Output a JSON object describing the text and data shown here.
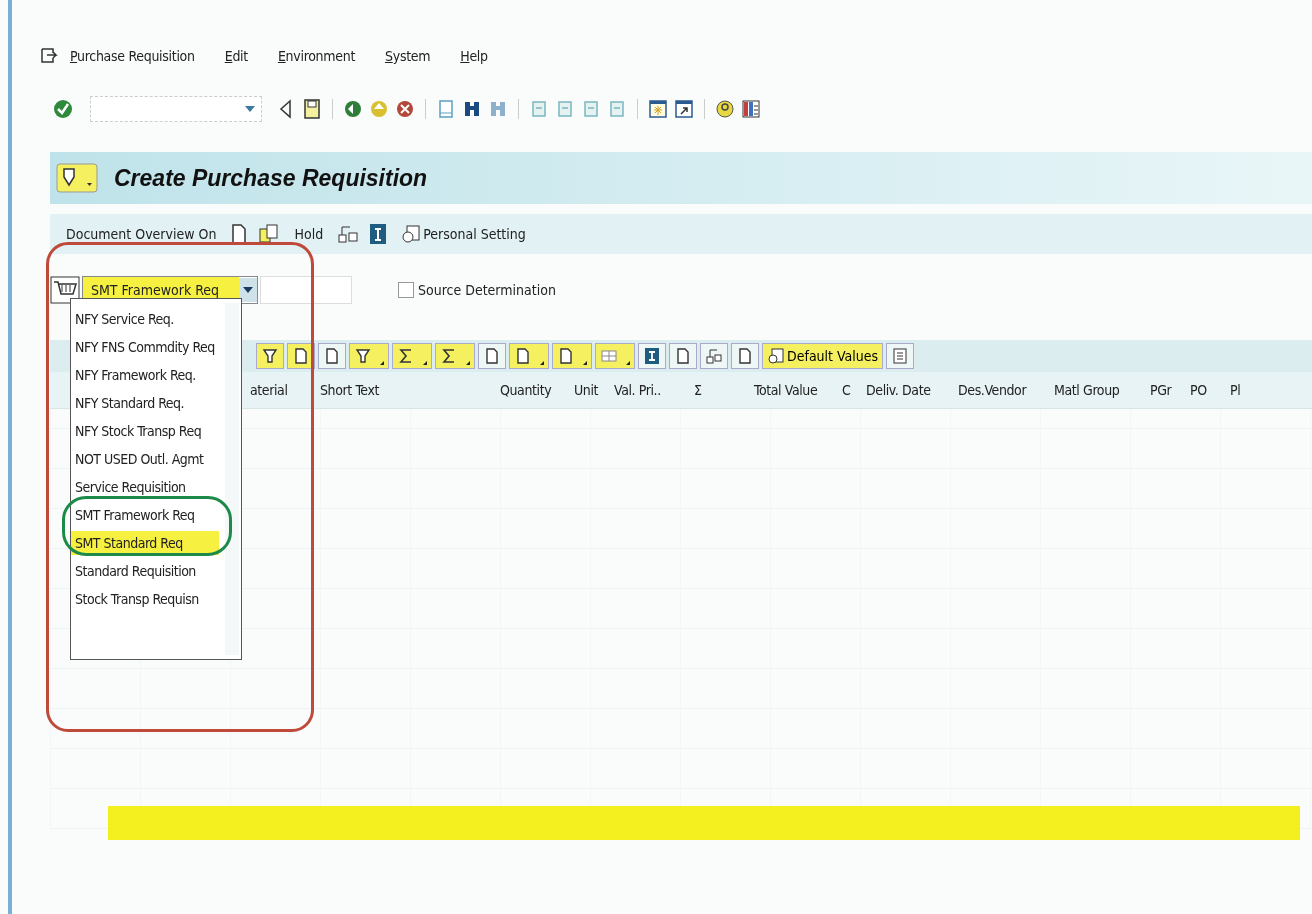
{
  "menu_bar": [
    "Purchase Requisition",
    "Edit",
    "Environment",
    "System",
    "Help"
  ],
  "title": "Create Purchase Requisition",
  "app_toolbar": {
    "document_overview": "Document Overview On",
    "hold": "Hold",
    "personal_setting": "Personal Setting"
  },
  "header": {
    "doc_type": {
      "value": "SMT Framework Req",
      "expanded": true
    },
    "source_determination": {
      "label": "Source Determination",
      "checked": false
    }
  },
  "doc_type_list": [
    {
      "label": "NFY  Service Req.",
      "selected": false
    },
    {
      "label": "NFY FNS Commdity Req",
      "selected": false
    },
    {
      "label": "NFY Framework Req.",
      "selected": false
    },
    {
      "label": "NFY Standard Req.",
      "selected": false
    },
    {
      "label": "NFY Stock Transp Req",
      "selected": false
    },
    {
      "label": "NOT USED Outl. Agmt",
      "selected": false
    },
    {
      "label": "Service Requisition",
      "selected": false
    },
    {
      "label": "SMT Framework Req",
      "selected": false
    },
    {
      "label": "SMT Standard Req",
      "selected": true
    },
    {
      "label": "Standard Requisition",
      "selected": false
    },
    {
      "label": "Stock Transp Requisn",
      "selected": false
    }
  ],
  "item_toolbar": {
    "default_values": "Default Values"
  },
  "item_table": {
    "columns": [
      "aterial",
      "Short Text",
      "Quantity",
      "Unit",
      "Val. Pri..",
      "Σ",
      "Total Value",
      "C",
      "Deliv. Date",
      "Des.Vendor",
      "Matl Group",
      "PGr",
      "PO",
      "Pl"
    ]
  }
}
